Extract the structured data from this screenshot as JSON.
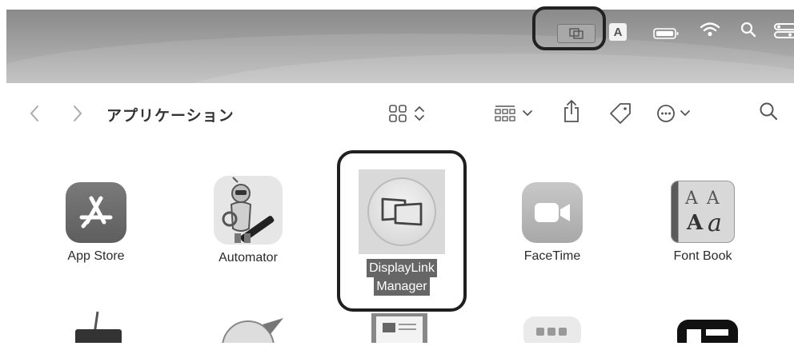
{
  "menubar": {
    "icons": [
      "displaylink-icon",
      "input-source-icon",
      "battery-icon",
      "wifi-icon",
      "spotlight-icon",
      "control-center-icon"
    ],
    "input_source_label": "A"
  },
  "finder": {
    "title": "アプリケーション",
    "toolbar_icons": [
      "back",
      "forward",
      "icon-view",
      "group",
      "share",
      "tag",
      "more",
      "search"
    ]
  },
  "apps": [
    {
      "label": "App Store"
    },
    {
      "label": "Automator"
    },
    {
      "label_line1": "DisplayLink",
      "label_line2": "Manager",
      "selected": true
    },
    {
      "label": "FaceTime"
    },
    {
      "label": "Font Book"
    }
  ],
  "fontbook_glyphs": {
    "row1": "A A",
    "row2a": "A",
    "row2b": "a"
  },
  "colors": {
    "highlight_border": "#1f1f1f",
    "selection_label_bg": "#666666"
  }
}
